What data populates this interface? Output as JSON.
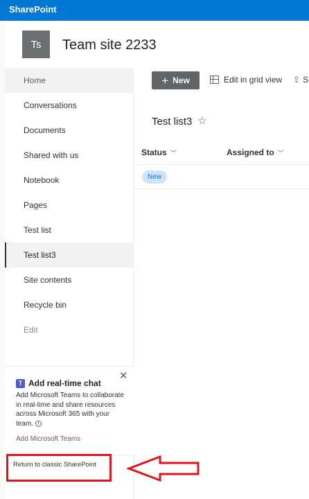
{
  "suite_bar": {
    "brand": "SharePoint"
  },
  "site": {
    "logo_initials": "Ts",
    "title": "Team site 2233"
  },
  "nav": {
    "items": [
      {
        "label": "Home"
      },
      {
        "label": "Conversations"
      },
      {
        "label": "Documents"
      },
      {
        "label": "Shared with us"
      },
      {
        "label": "Notebook"
      },
      {
        "label": "Pages"
      },
      {
        "label": "Test list"
      },
      {
        "label": "Test list3",
        "selected": true
      },
      {
        "label": "Site contents"
      },
      {
        "label": "Recycle bin"
      }
    ],
    "edit_label": "Edit"
  },
  "chat_card": {
    "title": "Add real-time chat",
    "body": "Add Microsoft Teams to collaborate in real-time and share resources across Microsoft 365 with your team.",
    "link": "Add Microsoft Teams",
    "close_glyph": "✕",
    "teams_glyph": "T"
  },
  "classic_link": "Return to classic SharePoint",
  "command_bar": {
    "new_label": "New",
    "new_glyph": "+",
    "grid_view_label": "Edit in grid view",
    "share_label": "S"
  },
  "list": {
    "title": "Test list3",
    "star_glyph": "☆",
    "columns": [
      {
        "label": "Status"
      },
      {
        "label": "Assigned to"
      }
    ],
    "rows": [
      {
        "status": "New"
      }
    ]
  },
  "colors": {
    "suite_bar": "#0078d4",
    "new_button": "#5f6569",
    "status_pill": "#cfe4fa",
    "annotation_red": "#e0131e"
  },
  "icons": {
    "chevron": "chevron-down-icon",
    "info": "info-icon",
    "star": "star-icon",
    "grid": "grid-view-icon",
    "share": "share-icon"
  }
}
